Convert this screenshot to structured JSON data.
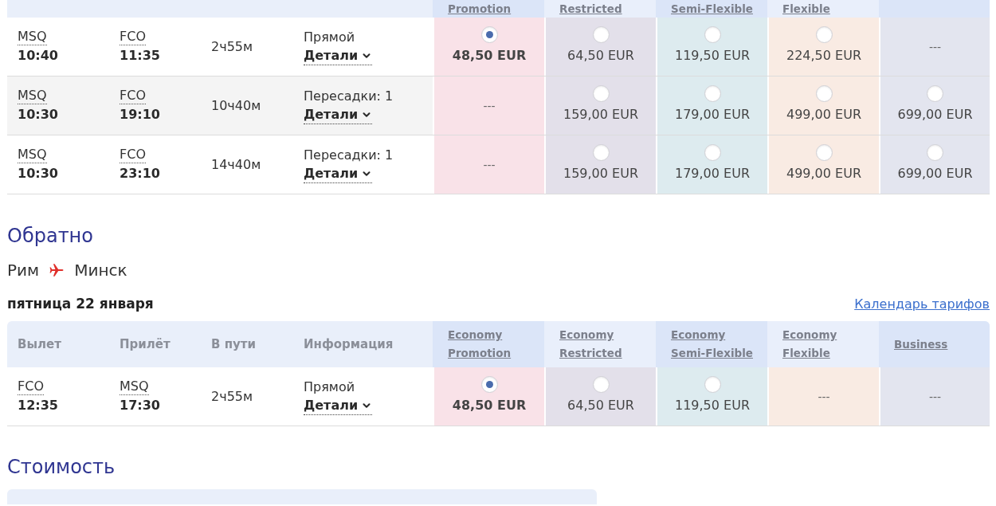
{
  "outbound": {
    "fare_columns": [
      {
        "kind": "promotion",
        "lines": [
          "Promotion"
        ]
      },
      {
        "kind": "restricted",
        "lines": [
          "Restricted"
        ]
      },
      {
        "kind": "semi_flexible",
        "lines": [
          "Semi-Flexible"
        ]
      },
      {
        "kind": "flexible",
        "lines": [
          "Flexible"
        ]
      },
      {
        "kind": "business"
      }
    ],
    "rows": [
      {
        "departure": {
          "code": "MSQ",
          "time": "10:40"
        },
        "arrival": {
          "code": "FCO",
          "time": "11:35"
        },
        "duration": "2ч55м",
        "info": "Прямой",
        "details": "Детали",
        "fares": [
          {
            "kind": "option",
            "price": "48,50 EUR",
            "selected": true
          },
          {
            "kind": "option",
            "price": "64,50 EUR",
            "selected": false
          },
          {
            "kind": "option",
            "price": "119,50 EUR",
            "selected": false
          },
          {
            "kind": "option",
            "price": "224,50 EUR",
            "selected": false
          },
          {
            "kind": "unavailable",
            "price": "---"
          }
        ]
      },
      {
        "departure": {
          "code": "MSQ",
          "time": "10:30"
        },
        "arrival": {
          "code": "FCO",
          "time": "19:10"
        },
        "duration": "10ч40м",
        "info": "Пересадки: 1",
        "details": "Детали",
        "fares": [
          {
            "kind": "unavailable",
            "price": "---"
          },
          {
            "kind": "option",
            "price": "159,00 EUR",
            "selected": false
          },
          {
            "kind": "option",
            "price": "179,00 EUR",
            "selected": false
          },
          {
            "kind": "option",
            "price": "499,00 EUR",
            "selected": false
          },
          {
            "kind": "option",
            "price": "699,00 EUR",
            "selected": false
          }
        ]
      },
      {
        "departure": {
          "code": "MSQ",
          "time": "10:30"
        },
        "arrival": {
          "code": "FCO",
          "time": "23:10"
        },
        "duration": "14ч40м",
        "info": "Пересадки: 1",
        "details": "Детали",
        "fares": [
          {
            "kind": "unavailable",
            "price": "---"
          },
          {
            "kind": "option",
            "price": "159,00 EUR",
            "selected": false
          },
          {
            "kind": "option",
            "price": "179,00 EUR",
            "selected": false
          },
          {
            "kind": "option",
            "price": "499,00 EUR",
            "selected": false
          },
          {
            "kind": "option",
            "price": "699,00 EUR",
            "selected": false
          }
        ]
      }
    ]
  },
  "return": {
    "title": "Обратно",
    "route": {
      "from": "Рим",
      "to": "Минск"
    },
    "date": "пятница 22 января",
    "calendar_link": "Календарь тарифов",
    "columns": [
      "Вылет",
      "Прилёт",
      "В пути",
      "Информация"
    ],
    "fare_columns": [
      {
        "kind": "promotion",
        "lines": [
          "Economy",
          "Promotion"
        ]
      },
      {
        "kind": "restricted",
        "lines": [
          "Economy",
          "Restricted"
        ]
      },
      {
        "kind": "semi_flexible",
        "lines": [
          "Economy",
          "Semi-Flexible"
        ]
      },
      {
        "kind": "flexible",
        "lines": [
          "Economy",
          "Flexible"
        ]
      },
      {
        "kind": "business",
        "lines": [
          "Business"
        ]
      }
    ],
    "rows": [
      {
        "departure": {
          "code": "FCO",
          "time": "12:35"
        },
        "arrival": {
          "code": "MSQ",
          "time": "17:30"
        },
        "duration": "2ч55м",
        "info": "Прямой",
        "details": "Детали",
        "fares": [
          {
            "kind": "option",
            "price": "48,50 EUR",
            "selected": true
          },
          {
            "kind": "option",
            "price": "64,50 EUR",
            "selected": false
          },
          {
            "kind": "option",
            "price": "119,50 EUR",
            "selected": false
          },
          {
            "kind": "unavailable",
            "price": "---"
          },
          {
            "kind": "unavailable",
            "price": "---"
          }
        ]
      }
    ]
  },
  "cost": {
    "title": "Стоимость"
  }
}
